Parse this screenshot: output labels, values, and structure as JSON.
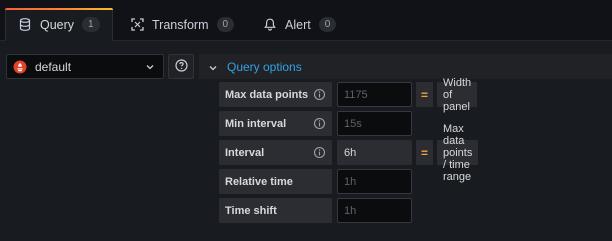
{
  "tabs": [
    {
      "label": "Query",
      "count": "1",
      "icon": "database-icon",
      "active": true
    },
    {
      "label": "Transform",
      "count": "0",
      "icon": "transform-icon",
      "active": false
    },
    {
      "label": "Alert",
      "count": "0",
      "icon": "bell-icon",
      "active": false
    }
  ],
  "datasource": {
    "selected": "default"
  },
  "query_options": {
    "title": "Query options"
  },
  "options": {
    "max_data_points": {
      "label": "Max data points",
      "value": "1175",
      "rhs": "Width of panel",
      "eq": "="
    },
    "min_interval": {
      "label": "Min interval",
      "value": "15s"
    },
    "interval": {
      "label": "Interval",
      "value": "6h",
      "rhs": "Max data points / time range",
      "eq": "="
    },
    "relative_time": {
      "label": "Relative time",
      "value": "1h"
    },
    "time_shift": {
      "label": "Time shift",
      "value": "1h"
    }
  },
  "colors": {
    "accent_blue": "#33a2e5",
    "tab_gradient_start": "#f55f3e",
    "tab_gradient_end": "#fbbf24",
    "equals_orange": "#f2a43a",
    "datasource_logo": "#e4422b"
  }
}
